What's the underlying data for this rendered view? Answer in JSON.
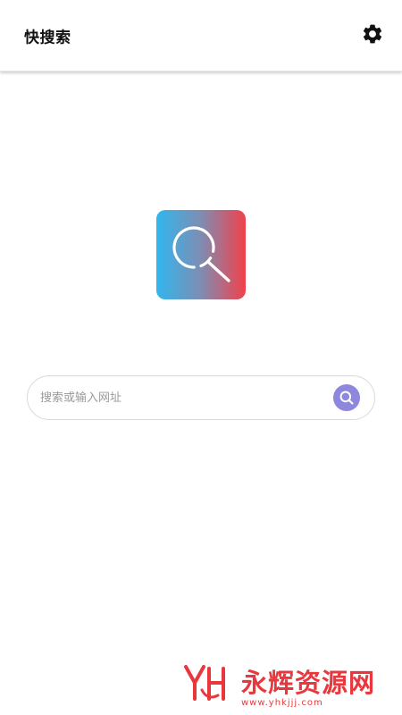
{
  "app_bar": {
    "title": "快搜索",
    "settings_icon": "gear-icon"
  },
  "logo": {
    "icon": "magnifier-icon",
    "gradient_colors": [
      "#31b6ee",
      "#7b8fb6",
      "#f2414b"
    ]
  },
  "search": {
    "placeholder": "搜索或输入网址",
    "value": "",
    "button_icon": "search-icon",
    "button_color": "#8d87de"
  },
  "watermark": {
    "brand": "永辉资源网",
    "url": "www.yhkjjj.com",
    "color": "#e8383d"
  }
}
